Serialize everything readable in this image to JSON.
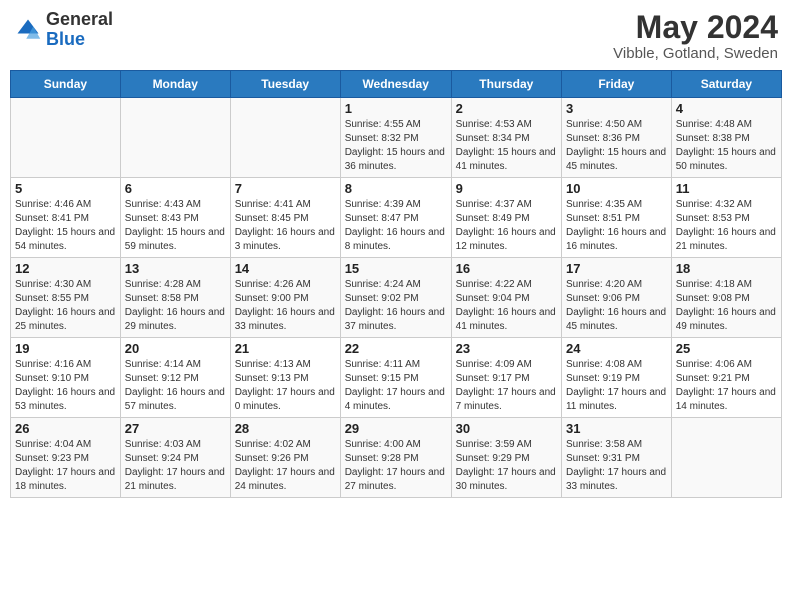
{
  "header": {
    "logo_general": "General",
    "logo_blue": "Blue",
    "month_year": "May 2024",
    "location": "Vibble, Gotland, Sweden"
  },
  "days_of_week": [
    "Sunday",
    "Monday",
    "Tuesday",
    "Wednesday",
    "Thursday",
    "Friday",
    "Saturday"
  ],
  "weeks": [
    [
      {
        "day": "",
        "info": ""
      },
      {
        "day": "",
        "info": ""
      },
      {
        "day": "",
        "info": ""
      },
      {
        "day": "1",
        "info": "Sunrise: 4:55 AM\nSunset: 8:32 PM\nDaylight: 15 hours and 36 minutes."
      },
      {
        "day": "2",
        "info": "Sunrise: 4:53 AM\nSunset: 8:34 PM\nDaylight: 15 hours and 41 minutes."
      },
      {
        "day": "3",
        "info": "Sunrise: 4:50 AM\nSunset: 8:36 PM\nDaylight: 15 hours and 45 minutes."
      },
      {
        "day": "4",
        "info": "Sunrise: 4:48 AM\nSunset: 8:38 PM\nDaylight: 15 hours and 50 minutes."
      }
    ],
    [
      {
        "day": "5",
        "info": "Sunrise: 4:46 AM\nSunset: 8:41 PM\nDaylight: 15 hours and 54 minutes."
      },
      {
        "day": "6",
        "info": "Sunrise: 4:43 AM\nSunset: 8:43 PM\nDaylight: 15 hours and 59 minutes."
      },
      {
        "day": "7",
        "info": "Sunrise: 4:41 AM\nSunset: 8:45 PM\nDaylight: 16 hours and 3 minutes."
      },
      {
        "day": "8",
        "info": "Sunrise: 4:39 AM\nSunset: 8:47 PM\nDaylight: 16 hours and 8 minutes."
      },
      {
        "day": "9",
        "info": "Sunrise: 4:37 AM\nSunset: 8:49 PM\nDaylight: 16 hours and 12 minutes."
      },
      {
        "day": "10",
        "info": "Sunrise: 4:35 AM\nSunset: 8:51 PM\nDaylight: 16 hours and 16 minutes."
      },
      {
        "day": "11",
        "info": "Sunrise: 4:32 AM\nSunset: 8:53 PM\nDaylight: 16 hours and 21 minutes."
      }
    ],
    [
      {
        "day": "12",
        "info": "Sunrise: 4:30 AM\nSunset: 8:55 PM\nDaylight: 16 hours and 25 minutes."
      },
      {
        "day": "13",
        "info": "Sunrise: 4:28 AM\nSunset: 8:58 PM\nDaylight: 16 hours and 29 minutes."
      },
      {
        "day": "14",
        "info": "Sunrise: 4:26 AM\nSunset: 9:00 PM\nDaylight: 16 hours and 33 minutes."
      },
      {
        "day": "15",
        "info": "Sunrise: 4:24 AM\nSunset: 9:02 PM\nDaylight: 16 hours and 37 minutes."
      },
      {
        "day": "16",
        "info": "Sunrise: 4:22 AM\nSunset: 9:04 PM\nDaylight: 16 hours and 41 minutes."
      },
      {
        "day": "17",
        "info": "Sunrise: 4:20 AM\nSunset: 9:06 PM\nDaylight: 16 hours and 45 minutes."
      },
      {
        "day": "18",
        "info": "Sunrise: 4:18 AM\nSunset: 9:08 PM\nDaylight: 16 hours and 49 minutes."
      }
    ],
    [
      {
        "day": "19",
        "info": "Sunrise: 4:16 AM\nSunset: 9:10 PM\nDaylight: 16 hours and 53 minutes."
      },
      {
        "day": "20",
        "info": "Sunrise: 4:14 AM\nSunset: 9:12 PM\nDaylight: 16 hours and 57 minutes."
      },
      {
        "day": "21",
        "info": "Sunrise: 4:13 AM\nSunset: 9:13 PM\nDaylight: 17 hours and 0 minutes."
      },
      {
        "day": "22",
        "info": "Sunrise: 4:11 AM\nSunset: 9:15 PM\nDaylight: 17 hours and 4 minutes."
      },
      {
        "day": "23",
        "info": "Sunrise: 4:09 AM\nSunset: 9:17 PM\nDaylight: 17 hours and 7 minutes."
      },
      {
        "day": "24",
        "info": "Sunrise: 4:08 AM\nSunset: 9:19 PM\nDaylight: 17 hours and 11 minutes."
      },
      {
        "day": "25",
        "info": "Sunrise: 4:06 AM\nSunset: 9:21 PM\nDaylight: 17 hours and 14 minutes."
      }
    ],
    [
      {
        "day": "26",
        "info": "Sunrise: 4:04 AM\nSunset: 9:23 PM\nDaylight: 17 hours and 18 minutes."
      },
      {
        "day": "27",
        "info": "Sunrise: 4:03 AM\nSunset: 9:24 PM\nDaylight: 17 hours and 21 minutes."
      },
      {
        "day": "28",
        "info": "Sunrise: 4:02 AM\nSunset: 9:26 PM\nDaylight: 17 hours and 24 minutes."
      },
      {
        "day": "29",
        "info": "Sunrise: 4:00 AM\nSunset: 9:28 PM\nDaylight: 17 hours and 27 minutes."
      },
      {
        "day": "30",
        "info": "Sunrise: 3:59 AM\nSunset: 9:29 PM\nDaylight: 17 hours and 30 minutes."
      },
      {
        "day": "31",
        "info": "Sunrise: 3:58 AM\nSunset: 9:31 PM\nDaylight: 17 hours and 33 minutes."
      },
      {
        "day": "",
        "info": ""
      }
    ]
  ]
}
